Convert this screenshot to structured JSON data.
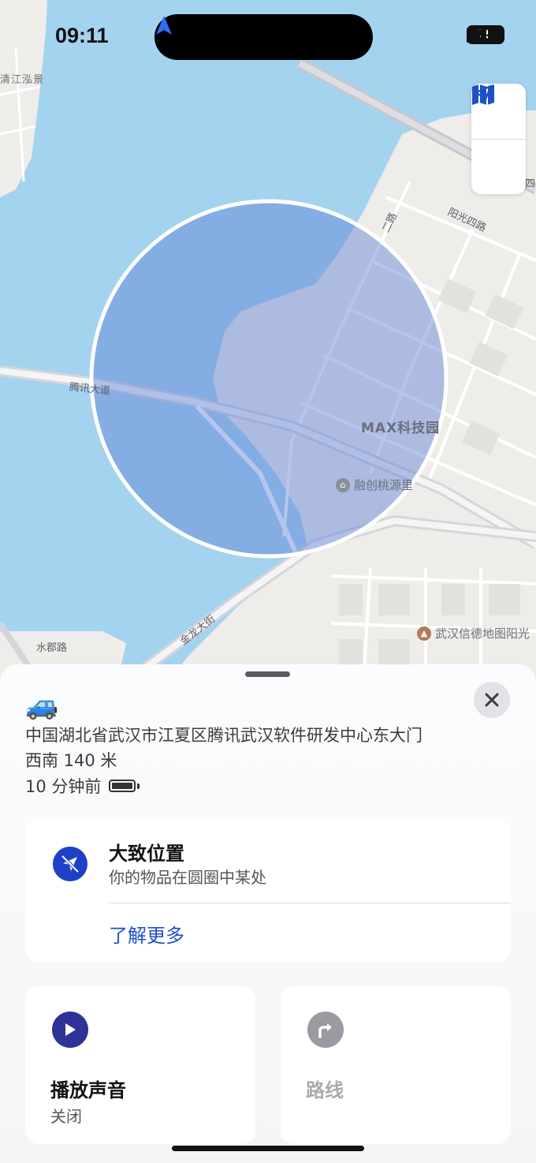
{
  "status_bar": {
    "time": "09:11",
    "battery": "75",
    "icons": [
      "location-arrow-icon",
      "cellular-signal-icon",
      "wifi-icon",
      "battery-icon"
    ]
  },
  "map": {
    "labels": {
      "top_left_area": "清江泓景",
      "road_tengxun": "腾讯大道",
      "road_yangguang4": "阳光四路",
      "road_top": "四",
      "road_jinlong": "金龙大街",
      "road_shuijun": "水郡路",
      "road_right_vertical": "二路",
      "poi_max": "MAX科技园",
      "poi_rongchuang": "融创桃源里",
      "poi_wuhan": "武汉信德地图阳光",
      "edge_right": "四"
    },
    "controls": {
      "map_mode_icon": "map-icon",
      "locate_icon": "location-arrow-icon"
    },
    "colors": {
      "water": "#a4d3ef",
      "land": "#eeede9",
      "circle_fill": "#5d7fd8",
      "circle_stroke": "#ffffff"
    }
  },
  "sheet": {
    "item_emoji": "🚙",
    "address": "中国湖北省武汉市江夏区腾讯武汉软件研发中心东大门",
    "distance": "西南 140 米",
    "last_seen": "10 分钟前",
    "approx_card": {
      "title": "大致位置",
      "subtitle": "你的物品在圆圈中某处",
      "link": "了解更多"
    },
    "actions": {
      "play_sound": {
        "title": "播放声音",
        "subtitle": "关闭"
      },
      "directions": {
        "title": "路线"
      }
    }
  }
}
